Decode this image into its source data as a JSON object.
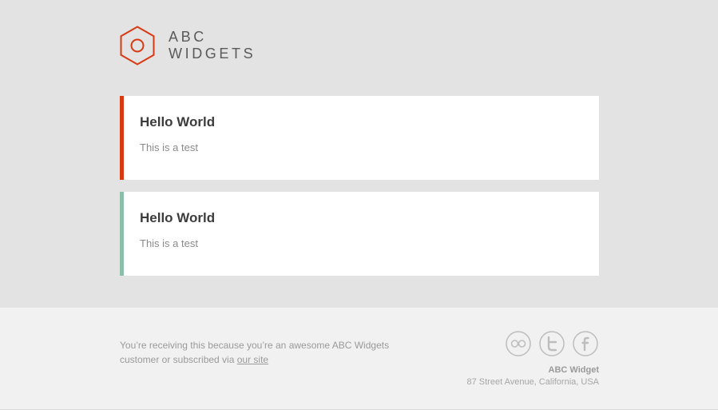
{
  "brand": {
    "name_line1": "ABC",
    "name_line2": "WIDGETS",
    "logo_icon": "hexagon-logo-icon",
    "accent_color": "#d73a13"
  },
  "cards": [
    {
      "title": "Hello World",
      "body": "This is a test",
      "accent_color": "#d73a13"
    },
    {
      "title": "Hello World",
      "body": "This is a test",
      "accent_color": "#8bbfaa"
    }
  ],
  "footer": {
    "message_prefix": "You’re receiving this because you’re an awesome ABC Widgets customer or subscribed via ",
    "link_text": "our site",
    "social_icons": [
      "flickr-icon",
      "twitter-icon",
      "facebook-icon"
    ],
    "company": "ABC Widget",
    "address": "87 Street Avenue, California, USA"
  }
}
